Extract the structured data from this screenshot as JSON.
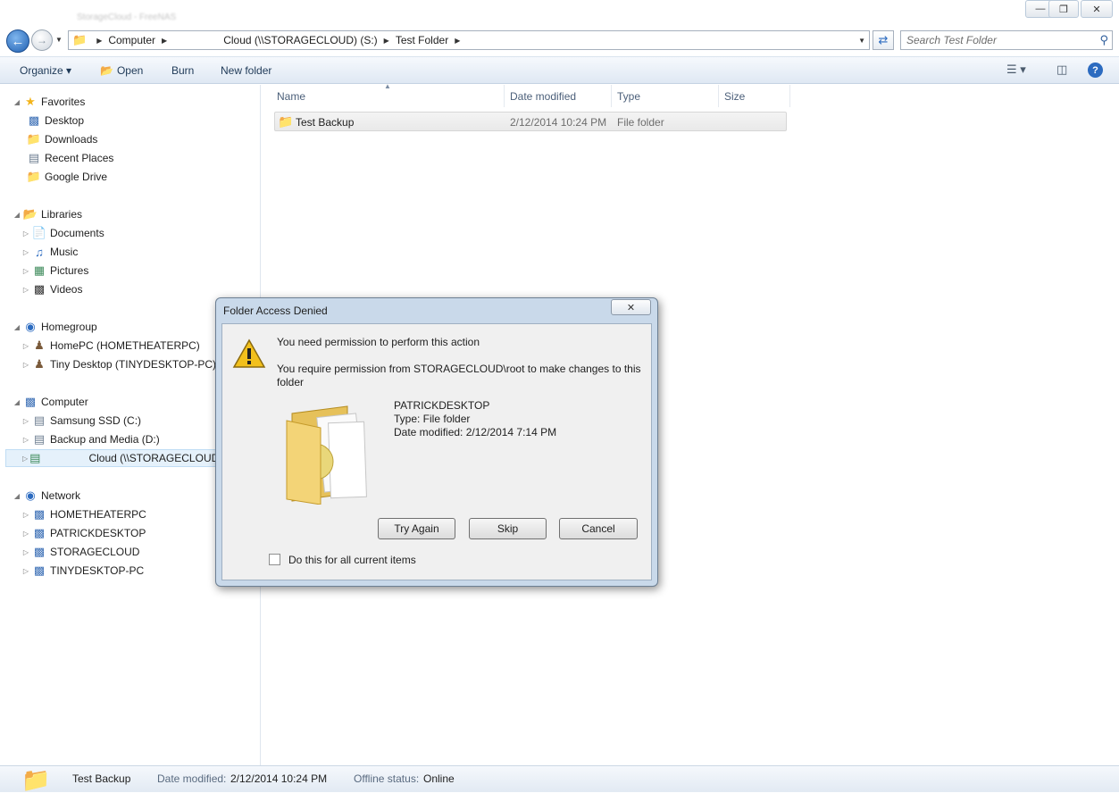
{
  "window": {
    "tab_title": "StorageCloud - FreeNAS",
    "minimize_glyph": "—",
    "restore_glyph": "❐",
    "close_glyph": "✕"
  },
  "address_bar": {
    "crumbs": [
      "Computer",
      "Cloud (\\\\STORAGECLOUD) (S:)",
      "Test Folder"
    ],
    "search_placeholder": "Search Test Folder"
  },
  "toolbar": {
    "organize": "Organize ▾",
    "open": "Open",
    "burn": "Burn",
    "new_folder": "New folder"
  },
  "nav": {
    "favorites": {
      "label": "Favorites",
      "items": [
        "Desktop",
        "Downloads",
        "Recent Places",
        "Google Drive"
      ]
    },
    "libraries": {
      "label": "Libraries",
      "items": [
        "Documents",
        "Music",
        "Pictures",
        "Videos"
      ]
    },
    "homegroup": {
      "label": "Homegroup",
      "items": [
        "HomePC (HOMETHEATERPC)",
        "Tiny Desktop (TINYDESKTOP-PC)"
      ]
    },
    "computer": {
      "label": "Computer",
      "items": [
        "Samsung SSD (C:)",
        "Backup and Media (D:)",
        "Cloud (\\\\STORAGECLOUD"
      ]
    },
    "network": {
      "label": "Network",
      "items": [
        "HOMETHEATERPC",
        "PATRICKDESKTOP",
        "STORAGECLOUD",
        "TINYDESKTOP-PC"
      ]
    }
  },
  "columns": [
    "Name",
    "Date modified",
    "Type",
    "Size"
  ],
  "files": [
    {
      "name": "Test Backup",
      "date": "2/12/2014 10:24 PM",
      "type": "File folder",
      "size": ""
    }
  ],
  "status": {
    "name": "Test Backup",
    "date_label": "Date modified:",
    "date_value": "2/12/2014 10:24 PM",
    "offline_label": "Offline status:",
    "offline_value": "Online"
  },
  "dialog": {
    "title": "Folder Access Denied",
    "close_glyph": "✕",
    "heading": "You need permission to perform this action",
    "message": "You require permission from STORAGECLOUD\\root to make changes to this folder",
    "item_name": "PATRICKDESKTOP",
    "item_type": "Type: File folder",
    "item_date": "Date modified: 2/12/2014 7:14 PM",
    "try_again": "Try Again",
    "skip": "Skip",
    "cancel": "Cancel",
    "checkbox_label": "Do this for all current items"
  },
  "colors": {
    "accent": "#1f5fb1",
    "dialog_frame": "#c9d9ea",
    "warning": "#f2c01c"
  }
}
